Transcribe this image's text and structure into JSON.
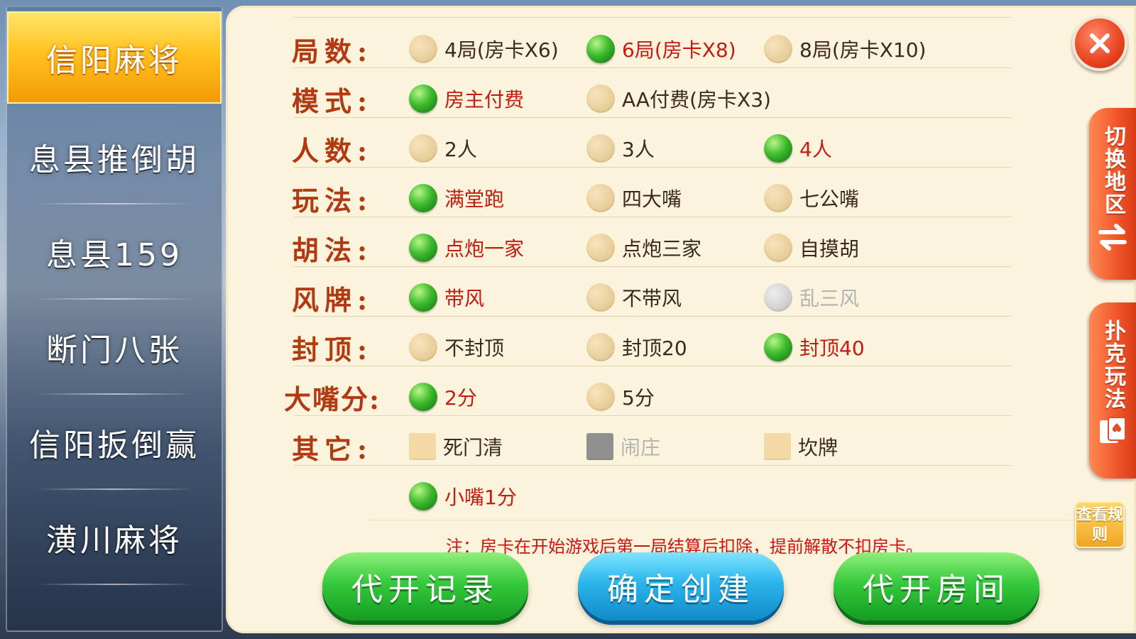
{
  "sidebar": {
    "items": [
      {
        "label": "信阳麻将",
        "active": true
      },
      {
        "label": "息县推倒胡",
        "active": false
      },
      {
        "label": "息县159",
        "active": false
      },
      {
        "label": "断门八张",
        "active": false
      },
      {
        "label": "信阳扳倒赢",
        "active": false
      },
      {
        "label": "潢川麻将",
        "active": false
      }
    ]
  },
  "options": {
    "rounds": {
      "label": "局数:",
      "choices": [
        "4局(房卡X6)",
        "6局(房卡X8)",
        "8局(房卡X10)"
      ],
      "selected": 1
    },
    "mode": {
      "label": "模式:",
      "choices": [
        "房主付费",
        "AA付费(房卡X3)"
      ],
      "selected": 0
    },
    "players": {
      "label": "人数:",
      "choices": [
        "2人",
        "3人",
        "4人"
      ],
      "selected": 2
    },
    "play": {
      "label": "玩法:",
      "choices": [
        "满堂跑",
        "四大嘴",
        "七公嘴"
      ],
      "selected": 0
    },
    "hu": {
      "label": "胡法:",
      "choices": [
        "点炮一家",
        "点炮三家",
        "自摸胡"
      ],
      "selected": 0
    },
    "wind": {
      "label": "风牌:",
      "choices": [
        "带风",
        "不带风",
        "乱三风"
      ],
      "selected": 0,
      "disabled": [
        2
      ]
    },
    "cap": {
      "label": "封顶:",
      "choices": [
        "不封顶",
        "封顶20",
        "封顶40"
      ],
      "selected": 2
    },
    "big_score": {
      "label": "大嘴分:",
      "choices": [
        "2分",
        "5分"
      ],
      "selected": 0
    },
    "other": {
      "label": "其它:",
      "choices": [
        "死门清",
        "闹庄",
        "坎牌"
      ],
      "disabled": [
        1
      ]
    },
    "small_score": {
      "choices": [
        "小嘴1分"
      ],
      "selected": 0
    }
  },
  "notice": "注：房卡在开始游戏后第一局结算后扣除，提前解散不扣房卡。",
  "buttons": {
    "proxy_record": "代开记录",
    "confirm_create": "确定创建",
    "proxy_room": "代开房间"
  },
  "right_tabs": {
    "switch_region": "切换地区",
    "poker_play": "扑克玩法",
    "view_rules": "查看规则"
  },
  "colors": {
    "panel_bg": "#fcf3dc",
    "label": "#b23a12",
    "selected_text": "#c41b12",
    "radio_on": "#3fbb2d",
    "notice": "#d0130f",
    "active_tab": "#ffc21f"
  }
}
